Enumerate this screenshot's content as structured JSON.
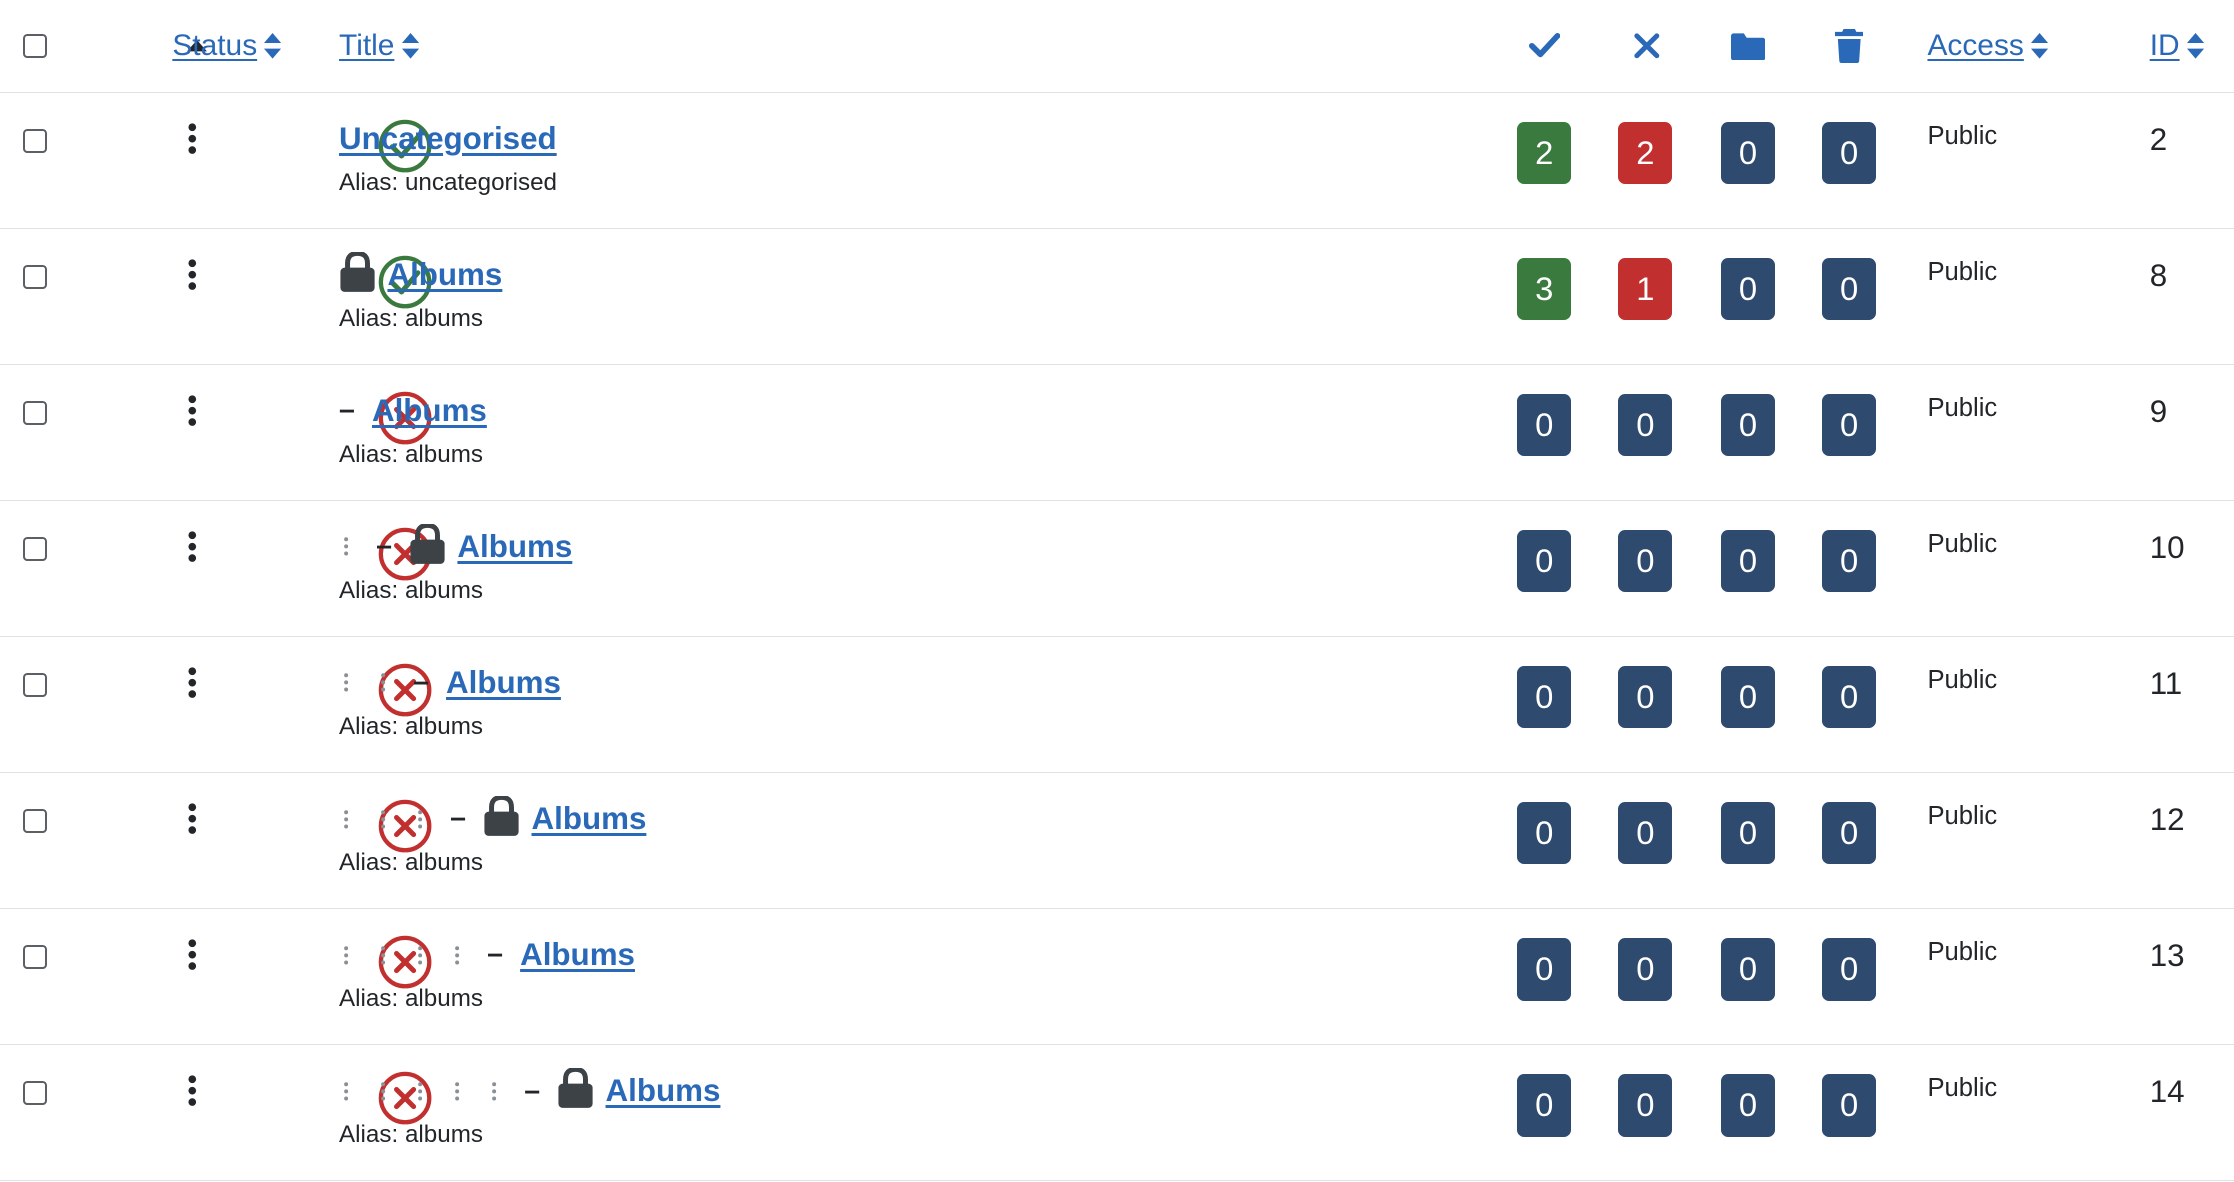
{
  "header": {
    "status_label": "Status",
    "title_label": "Title",
    "access_label": "Access",
    "id_label": "ID",
    "icons": [
      "order-up-caret-icon",
      "published-check-icon",
      "unpublished-x-icon",
      "archived-folder-icon",
      "trashed-trash-icon",
      "sort-icon"
    ]
  },
  "colors": {
    "link": "#2a69b8",
    "published": "#3b7a3e",
    "unpublished": "#c22f2f",
    "badge_published": "#3b7a3e",
    "badge_unpublished": "#c22f2f",
    "badge_other": "#2e4a6e"
  },
  "rows": [
    {
      "status": "published",
      "level": 0,
      "dash": "",
      "locked": false,
      "title": "Uncategorised",
      "alias": "Alias: uncategorised",
      "published": "2",
      "unpublished": "2",
      "archived": "0",
      "trashed": "0",
      "access": "Public",
      "id": "2"
    },
    {
      "status": "published",
      "level": 0,
      "dash": "",
      "locked": true,
      "title": "Albums",
      "alias": "Alias: albums",
      "published": "3",
      "unpublished": "1",
      "archived": "0",
      "trashed": "0",
      "access": "Public",
      "id": "8"
    },
    {
      "status": "unpublished",
      "level": 0,
      "dash": "–",
      "locked": false,
      "title": "Albums",
      "alias": "Alias: albums",
      "published": "0",
      "unpublished": "0",
      "archived": "0",
      "trashed": "0",
      "access": "Public",
      "id": "9"
    },
    {
      "status": "unpublished",
      "level": 1,
      "dash": "–",
      "locked": true,
      "title": "Albums",
      "alias": "Alias: albums",
      "published": "0",
      "unpublished": "0",
      "archived": "0",
      "trashed": "0",
      "access": "Public",
      "id": "10"
    },
    {
      "status": "unpublished",
      "level": 2,
      "dash": "–",
      "locked": false,
      "title": "Albums",
      "alias": "Alias: albums",
      "published": "0",
      "unpublished": "0",
      "archived": "0",
      "trashed": "0",
      "access": "Public",
      "id": "11"
    },
    {
      "status": "unpublished",
      "level": 3,
      "dash": "–",
      "locked": true,
      "title": "Albums",
      "alias": "Alias: albums",
      "published": "0",
      "unpublished": "0",
      "archived": "0",
      "trashed": "0",
      "access": "Public",
      "id": "12"
    },
    {
      "status": "unpublished",
      "level": 4,
      "dash": "–",
      "locked": false,
      "title": "Albums",
      "alias": "Alias: albums",
      "published": "0",
      "unpublished": "0",
      "archived": "0",
      "trashed": "0",
      "access": "Public",
      "id": "13"
    },
    {
      "status": "unpublished",
      "level": 5,
      "dash": "–",
      "locked": true,
      "title": "Albums",
      "alias": "Alias: albums",
      "published": "0",
      "unpublished": "0",
      "archived": "0",
      "trashed": "0",
      "access": "Public",
      "id": "14"
    }
  ]
}
